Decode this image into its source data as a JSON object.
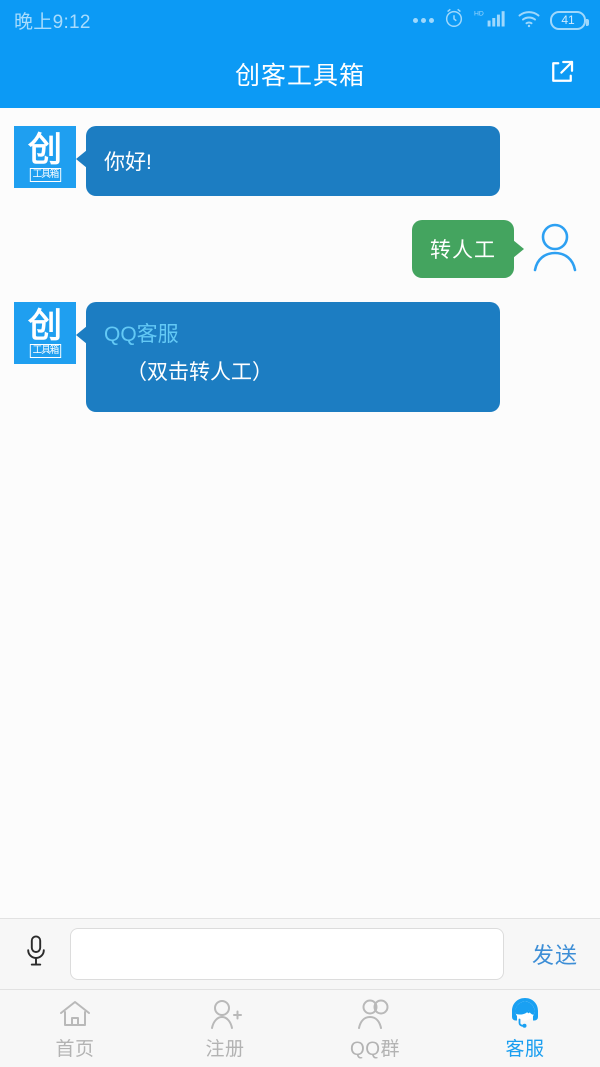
{
  "status_bar": {
    "time": "晚上9:12",
    "battery_level": "41",
    "icons": [
      "more-dots-icon",
      "alarm-clock-icon",
      "hd-signal-icon",
      "wifi-icon",
      "battery-icon"
    ]
  },
  "header": {
    "title": "创客工具箱",
    "share_icon": "share-icon"
  },
  "avatar": {
    "bot_logo_main": "创",
    "bot_logo_sub": "工具箱"
  },
  "messages": [
    {
      "id": "msg-1",
      "sender": "bot",
      "text": "你好!"
    },
    {
      "id": "msg-2",
      "sender": "user",
      "text": "转人工"
    },
    {
      "id": "msg-3",
      "sender": "bot",
      "link_text": "QQ客服",
      "sub_text": "（双击转人工）"
    }
  ],
  "input_bar": {
    "mic_icon": "microphone-icon",
    "input_value": "",
    "input_placeholder": "",
    "send_label": "发送"
  },
  "tab_bar": {
    "tabs": [
      {
        "label": "首页",
        "icon": "home-icon",
        "active": false
      },
      {
        "label": "注册",
        "icon": "user-plus-icon",
        "active": false
      },
      {
        "label": "QQ群",
        "icon": "users-group-icon",
        "active": false
      },
      {
        "label": "客服",
        "icon": "headset-agent-icon",
        "active": true
      }
    ]
  },
  "colors": {
    "header_blue": "#0c9af5",
    "bot_bubble_blue": "#1c7dc2",
    "user_bubble_green": "#44a45f",
    "link_cyan": "#63c9f5",
    "send_blue": "#3d8ed6",
    "active_tab_blue": "#1a9ef0",
    "inactive_tab_gray": "#b3b3b3",
    "chat_background": "#fcfcfc"
  }
}
